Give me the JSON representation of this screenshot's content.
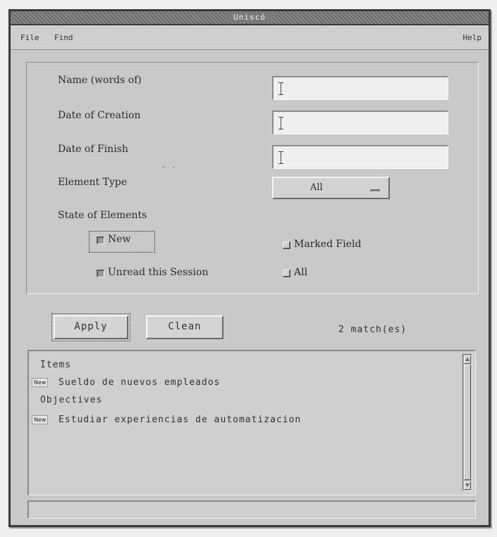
{
  "window": {
    "title": "Uniscó"
  },
  "menubar": {
    "file": "File",
    "find": "Find",
    "help": "Help"
  },
  "form": {
    "name_label": "Name (words of)",
    "name_value": "",
    "date_creation_label": "Date of Creation",
    "date_creation_value": "",
    "date_finish_label": "Date of Finish",
    "date_finish_value": "",
    "element_type_label": "Element Type",
    "element_type_value": "All",
    "state_label": "State of Elements",
    "states": [
      {
        "label": "New",
        "checked": true
      },
      {
        "label": "Marked Field",
        "checked": false
      },
      {
        "label": "Unread this Session",
        "checked": true
      },
      {
        "label": "All",
        "checked": false
      }
    ]
  },
  "actions": {
    "apply_label": "Apply",
    "clean_label": "Clean",
    "match_count": "2 match(es)"
  },
  "results": {
    "categories": [
      {
        "name": "Items",
        "entries": [
          {
            "badge": "New",
            "text": "Sueldo de nuevos empleados"
          }
        ]
      },
      {
        "name": "Objectives",
        "entries": [
          {
            "badge": "New",
            "text": "Estudiar experiencias de automatizacion"
          }
        ]
      }
    ]
  },
  "pointer": {
    "glyph": "· ·"
  },
  "status": {
    "text": ""
  }
}
